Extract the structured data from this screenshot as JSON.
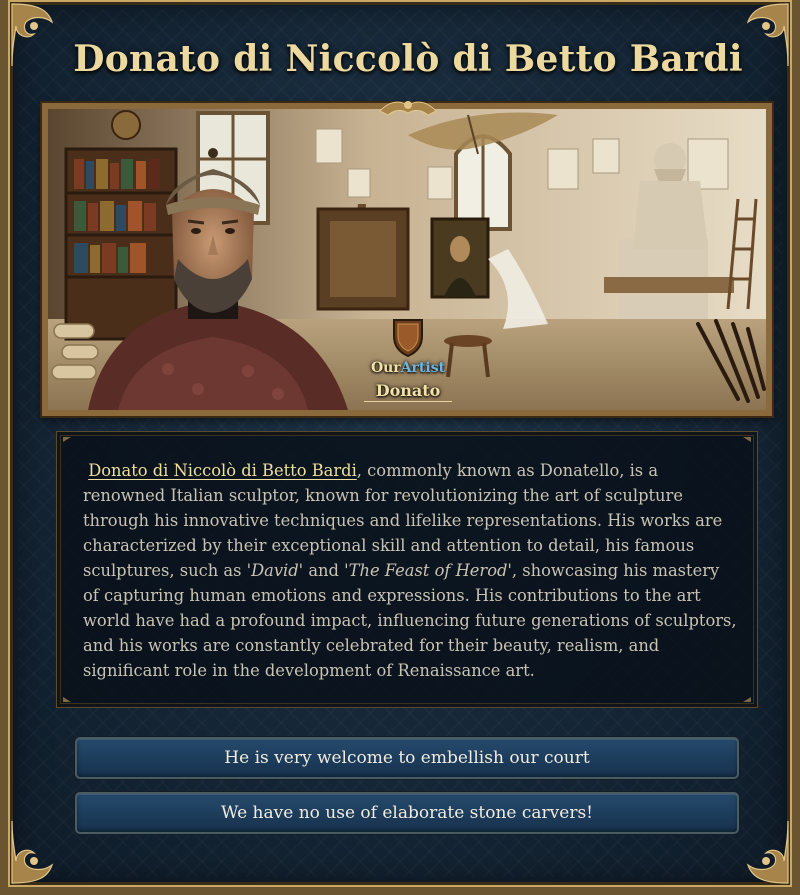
{
  "event": {
    "title": "Donato di Niccolò di Betto Bardi",
    "portrait": {
      "label_word_1": "Our",
      "label_word_2": "Artist",
      "name": "Donato"
    },
    "description": {
      "link_text": "Donato di Niccolò di Betto Bardi",
      "text_1": ", commonly known as Donatello, is a renowned Italian sculptor, known for revolutionizing the art of sculpture through his innovative techniques and lifelike representations. His works are characterized by their exceptional skill and attention to detail, his famous sculptures, such as '",
      "work_1": "David",
      "text_2": "' and '",
      "work_2": "The Feast of Herod",
      "text_3": "', showcasing his mastery of capturing human emotions and expressions. His contributions to the art world have had a profound impact, influencing future generations of sculptors, and his works are constantly celebrated for their beauty, realism, and significant role in the development of Renaissance art."
    },
    "choices": [
      {
        "label": "He is very welcome to embellish our court"
      },
      {
        "label": "We have no use of elaborate stone carvers!"
      }
    ]
  },
  "colors": {
    "panel_background": "#152636",
    "frame_gold": "#c9a866",
    "title_text": "#ecd9a0",
    "link_text": "#efdf9c",
    "body_text": "#c9c3b3",
    "button_blue": "#1d3d5d",
    "artist_highlight": "#6fb7e0"
  },
  "icons": [
    "ornate-corner-icon",
    "crest-icon",
    "artist-shield-icon"
  ]
}
